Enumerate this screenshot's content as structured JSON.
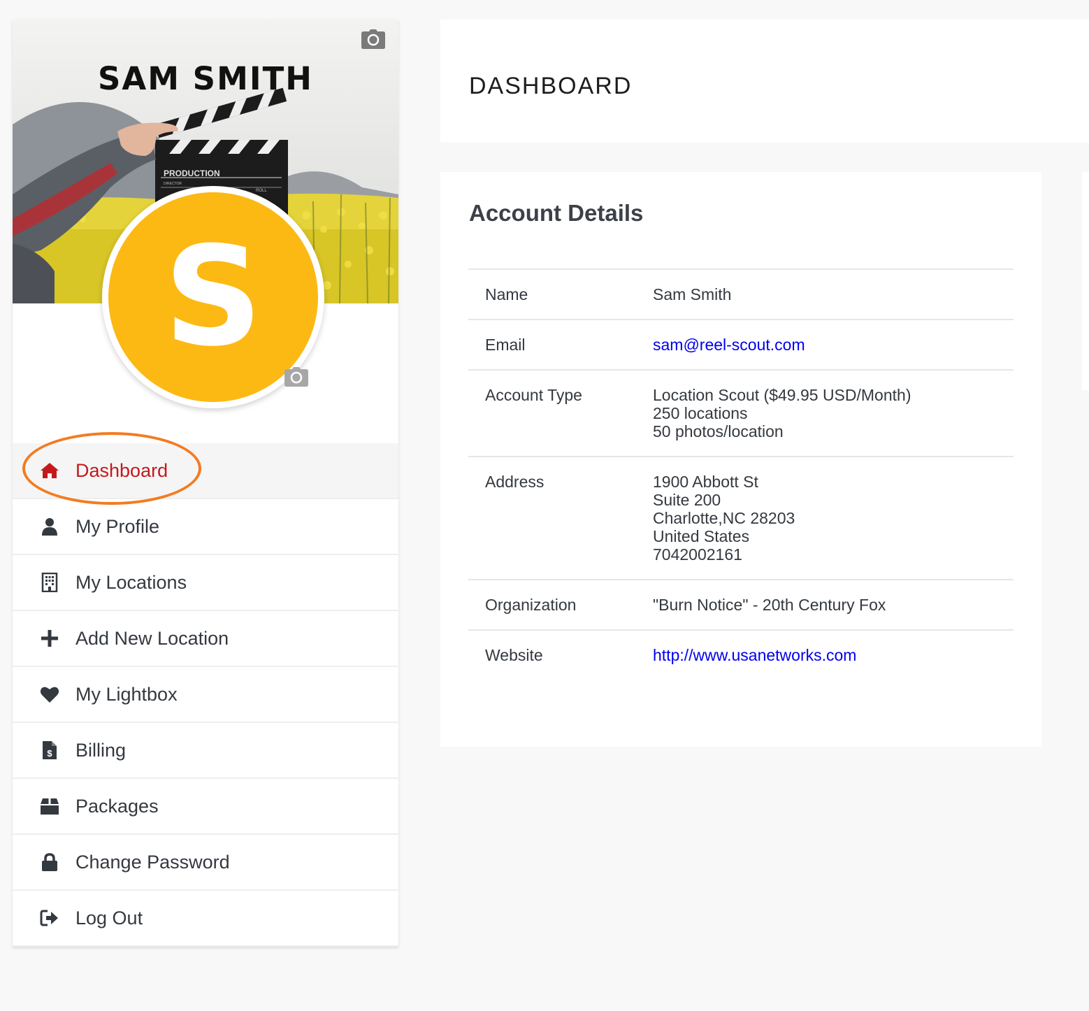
{
  "profile": {
    "name": "SAM SMITH",
    "avatar_letter": "S",
    "cover_text": [
      "PRODUCTION",
      "DIRECTOR",
      "ROLL"
    ],
    "avatar_color": "#fdb913"
  },
  "icons": {
    "camera": "camera-icon"
  },
  "nav": {
    "active_color": "#c4191c",
    "highlight_color": "#f47b20",
    "items": [
      {
        "label": "Dashboard",
        "icon": "home-icon",
        "active": true
      },
      {
        "label": "My Profile",
        "icon": "user-icon"
      },
      {
        "label": "My Locations",
        "icon": "building-icon"
      },
      {
        "label": "Add New Location",
        "icon": "plus-icon"
      },
      {
        "label": "My Lightbox",
        "icon": "heart-icon"
      },
      {
        "label": "Billing",
        "icon": "invoice-icon"
      },
      {
        "label": "Packages",
        "icon": "box-icon"
      },
      {
        "label": "Change Password",
        "icon": "lock-icon"
      },
      {
        "label": "Log Out",
        "icon": "sign-out-icon"
      }
    ]
  },
  "header": {
    "title": "DASHBOARD"
  },
  "account": {
    "title": "Account Details",
    "rows": [
      {
        "label": "Name",
        "lines": [
          "Sam Smith"
        ]
      },
      {
        "label": "Email",
        "link": "sam@reel-scout.com"
      },
      {
        "label": "Account Type",
        "lines": [
          "Location Scout ($49.95 USD/Month)",
          "250 locations",
          "50 photos/location"
        ]
      },
      {
        "label": "Address",
        "lines": [
          "1900 Abbott St",
          "Suite 200",
          "Charlotte,NC 28203",
          "United States",
          "7042002161"
        ]
      },
      {
        "label": "Organization",
        "lines": [
          "\"Burn Notice\" - 20th Century Fox"
        ]
      },
      {
        "label": "Website",
        "link": "http://www.usanetworks.com"
      }
    ],
    "link_color": "#0000ee"
  }
}
